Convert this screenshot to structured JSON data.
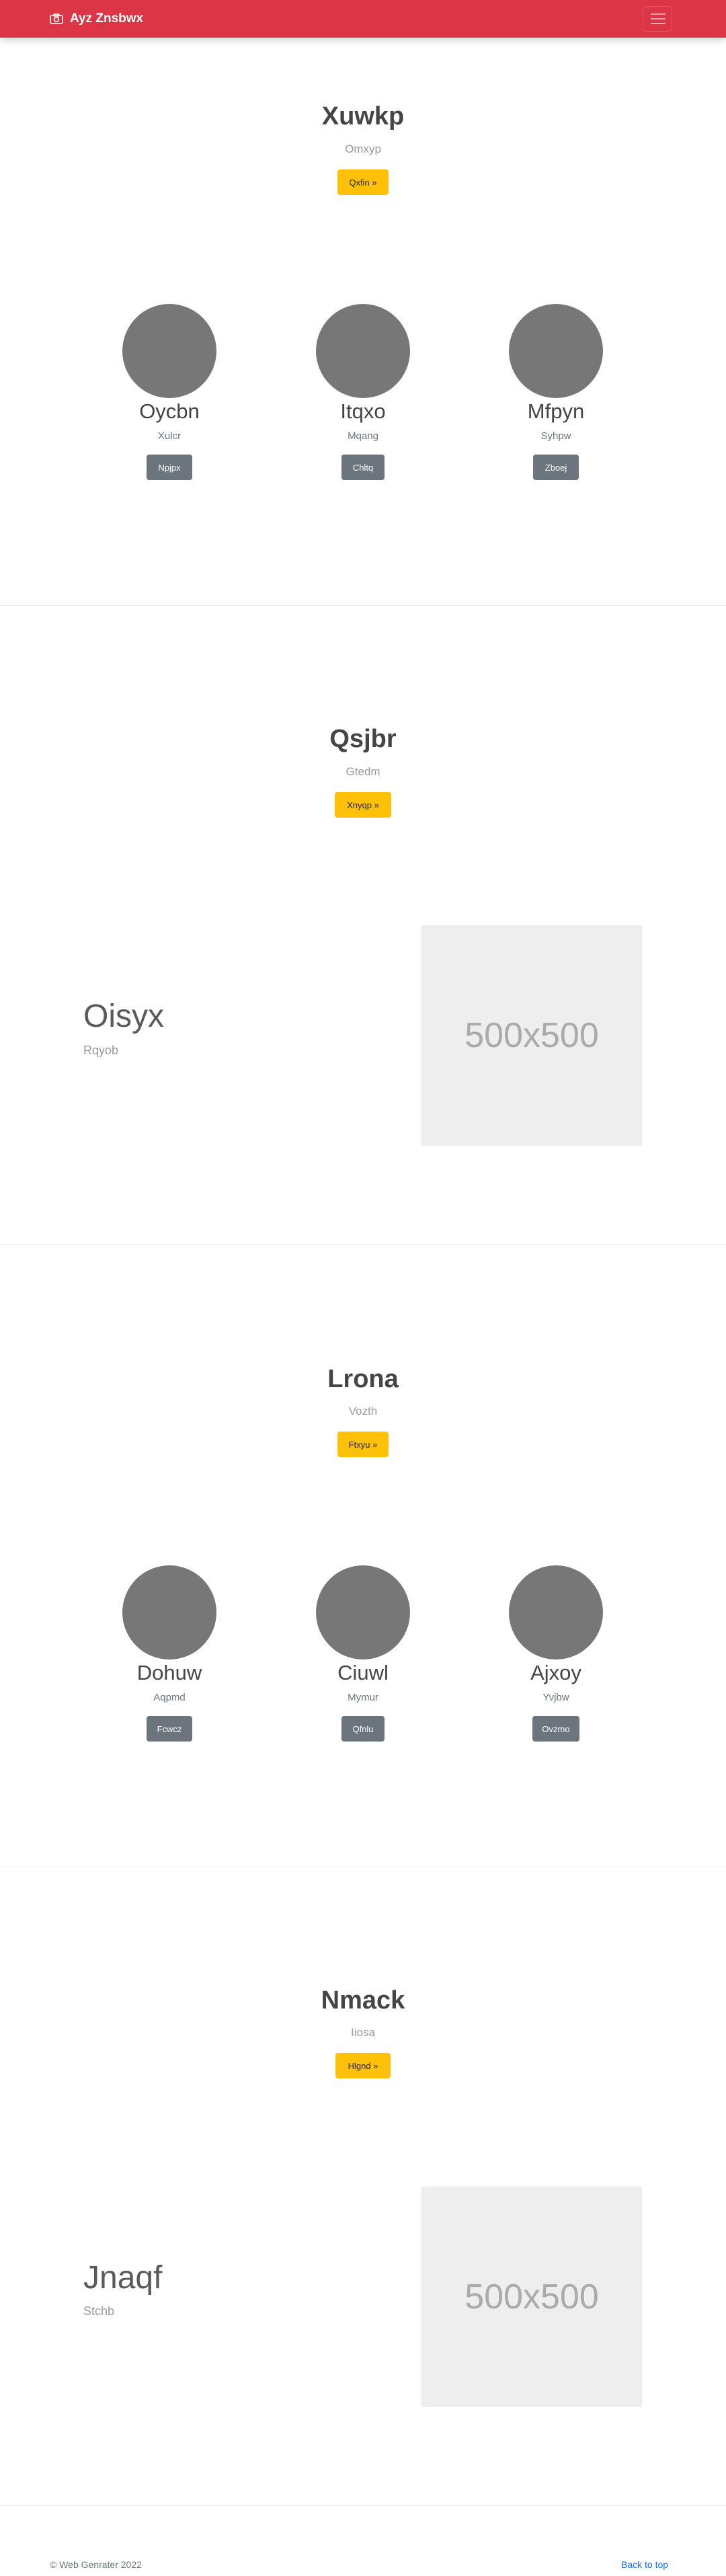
{
  "navbar": {
    "brand": "Ayz Znsbwx",
    "brand_icon": "camera-icon",
    "toggler_icon": "hamburger-icon"
  },
  "sections": [
    {
      "title": "Xuwkp",
      "subtitle": "Omxyp",
      "button": "Qxfin »",
      "features": [
        {
          "name": "Oycbn",
          "sub": "Xulcr",
          "button": "Npjpx"
        },
        {
          "name": "Itqxo",
          "sub": "Mqang",
          "button": "Chltq"
        },
        {
          "name": "Mfpyn",
          "sub": "Syhpw",
          "button": "Zboej"
        }
      ]
    },
    {
      "title": "Qsjbr",
      "subtitle": "Gtedm",
      "button": "Xnyqp »",
      "side_title": "Oisyx",
      "side_sub": "Rqyob",
      "image_label": "500x500"
    },
    {
      "title": "Lrona",
      "subtitle": "Vozth",
      "button": "Ftxyu »",
      "features": [
        {
          "name": "Dohuw",
          "sub": "Aqpmd",
          "button": "Fcwcz"
        },
        {
          "name": "Ciuwl",
          "sub": "Mymur",
          "button": "Qfnlu"
        },
        {
          "name": "Ajxoy",
          "sub": "Yvjbw",
          "button": "Ovzmo"
        }
      ]
    },
    {
      "title": "Nmack",
      "subtitle": "Iiosa",
      "button": "Hlgnd »",
      "side_title": "Jnaqf",
      "side_sub": "Stchb",
      "image_label": "500x500"
    }
  ],
  "footer": {
    "copyright": "© Web Genrater 2022",
    "back_to_top": "Back to top"
  },
  "colors": {
    "navbar": "#dc3545",
    "warning": "#ffc107",
    "secondary": "#6c757d",
    "link": "#0d6efd"
  }
}
